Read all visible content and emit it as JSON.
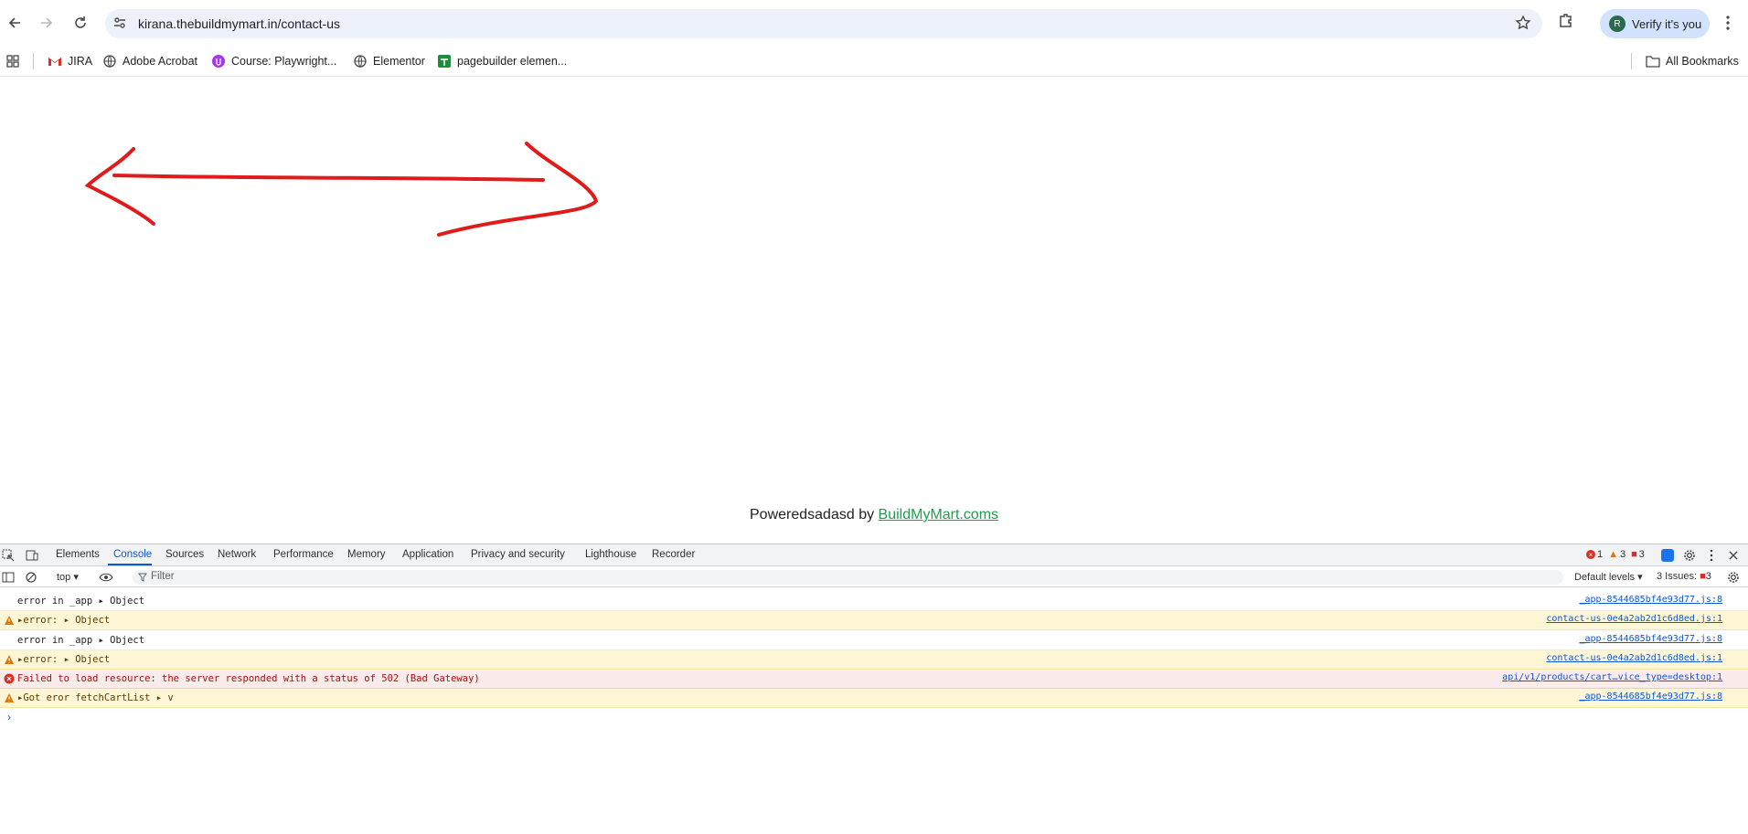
{
  "browser": {
    "url": "kirana.thebuildmymart.in/contact-us",
    "profile_button": "Verify it's you",
    "profile_initial": "R"
  },
  "bookmarks": {
    "items": [
      {
        "label": "JIRA",
        "icon": "gmail-icon"
      },
      {
        "label": "Adobe Acrobat",
        "icon": "globe-icon"
      },
      {
        "label": "Course: Playwright...",
        "icon": "course-icon"
      },
      {
        "label": "Elementor",
        "icon": "globe-icon"
      },
      {
        "label": "pagebuilder elemen...",
        "icon": "sheets-icon"
      }
    ],
    "all_bookmarks": "All Bookmarks"
  },
  "page": {
    "footer_prefix": "Poweredsadasd by ",
    "footer_link": "BuildMyMart.coms"
  },
  "devtools": {
    "tabs": [
      "Elements",
      "Console",
      "Sources",
      "Network",
      "Performance",
      "Memory",
      "Application",
      "Privacy and security",
      "Lighthouse",
      "Recorder"
    ],
    "active_tab": "Console",
    "error_count": "1",
    "warning_count": "3",
    "info_count": "3",
    "context": "top",
    "filter_placeholder": "Filter",
    "levels": "Default levels",
    "issues_label": "3 Issues:",
    "issues_count": "3",
    "logs": [
      {
        "level": "log",
        "message": "error in _app  ▸ Object",
        "source": "_app-8544685bf4e93d77.js:8"
      },
      {
        "level": "warn",
        "message": "▸error:  ▸ Object",
        "source": "contact-us-0e4a2ab2d1c6d8ed.js:1"
      },
      {
        "level": "log",
        "message": "error in _app  ▸ Object",
        "source": "_app-8544685bf4e93d77.js:8"
      },
      {
        "level": "warn",
        "message": "▸error:  ▸ Object",
        "source": "contact-us-0e4a2ab2d1c6d8ed.js:1"
      },
      {
        "level": "err",
        "message": "Failed to load resource: the server responded with a status of 502 (Bad Gateway)",
        "source": "api/v1/products/cart…vice_type=desktop:1"
      },
      {
        "level": "warn",
        "message": "▸Got eror fetchCartList  ▸ v",
        "source": "_app-8544685bf4e93d77.js:8"
      }
    ]
  },
  "colors": {
    "arrow": "#e01b1b",
    "link": "#1e9e4b",
    "devtools_accent": "#0b57d0"
  }
}
